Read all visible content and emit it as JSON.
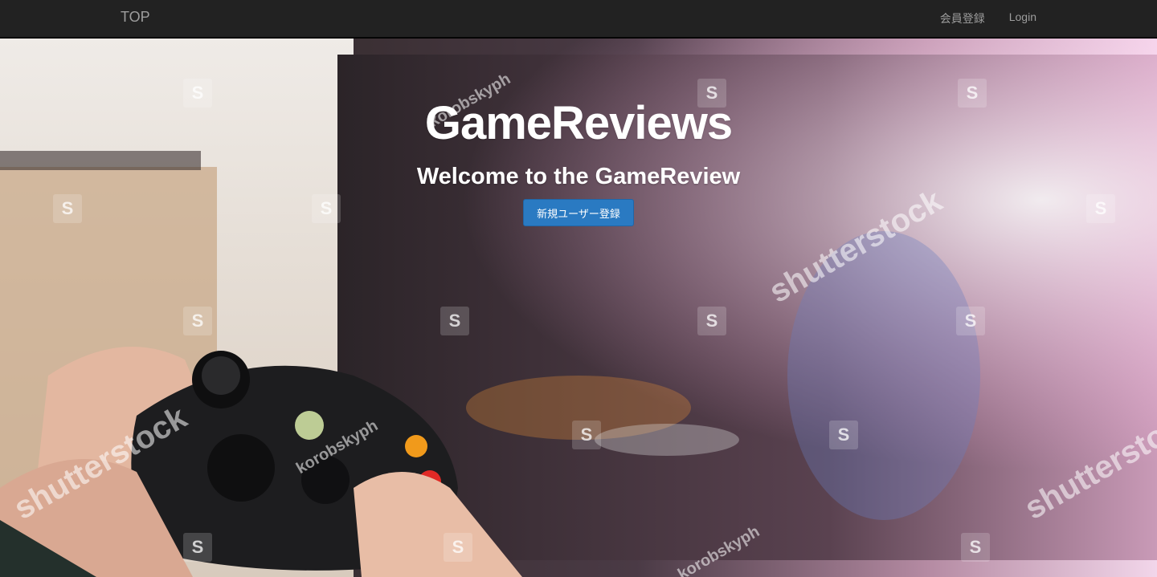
{
  "navbar": {
    "brand": "TOP",
    "links": [
      "会員登録",
      "Login"
    ]
  },
  "hero": {
    "title": "GameReviews",
    "subtitle": "Welcome to the GameReview",
    "signup_label": "新規ユーザー登録",
    "background": "blurred TV game scene with hands holding a game controller",
    "watermarks": {
      "stock": "shutterstock",
      "author": "korobskyph",
      "logo_mark": "S"
    }
  },
  "colors": {
    "navbar": "#222222",
    "nav_text": "#9d9d9d",
    "button": "#2a7ac2",
    "title_text": "#ffffff"
  }
}
